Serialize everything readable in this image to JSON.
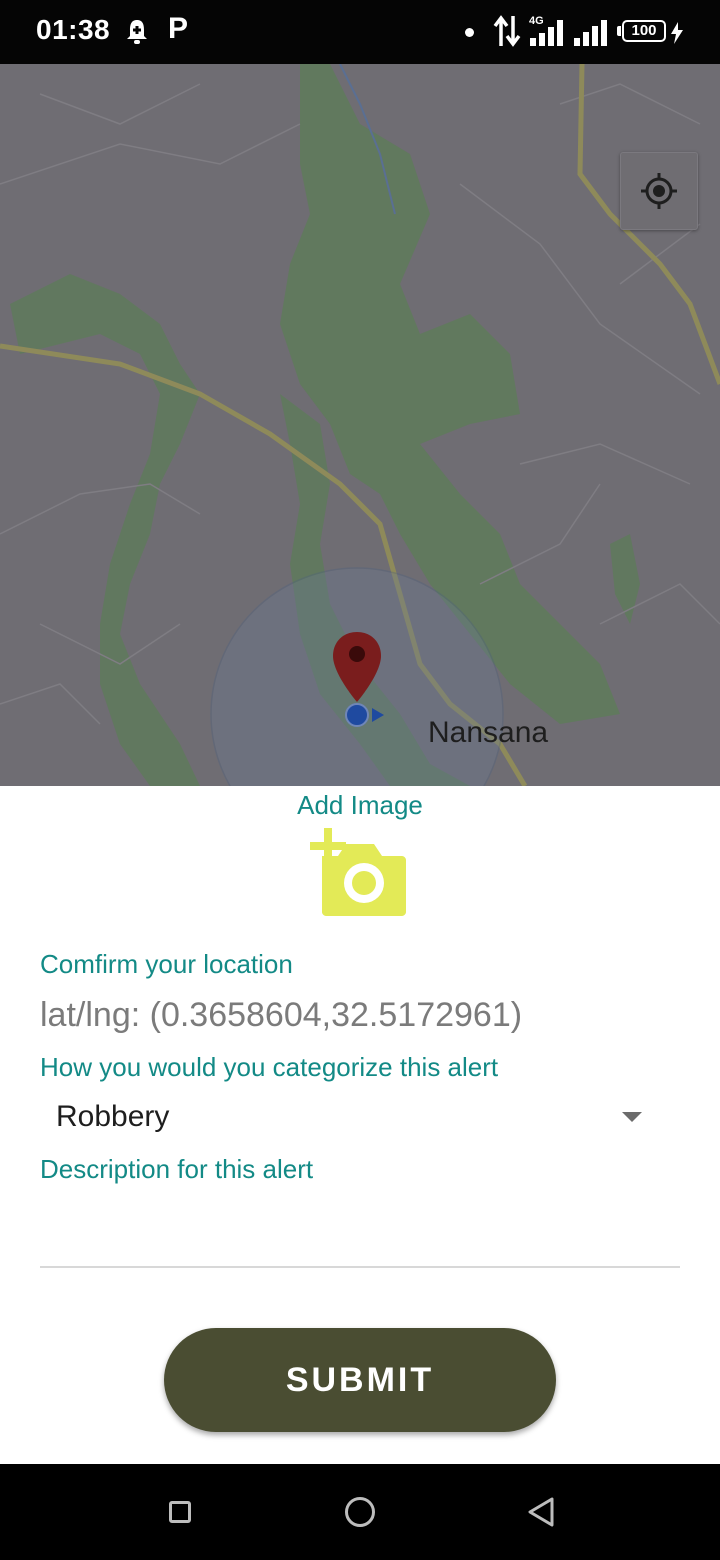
{
  "status_bar": {
    "time": "01:38",
    "p_icon": "P",
    "network": "4G",
    "battery": "100"
  },
  "map": {
    "place_label": "Nansana",
    "icons": [
      "my-location-icon",
      "map-pin-icon",
      "current-location-dot-icon"
    ]
  },
  "form": {
    "add_image_label": "Add Image",
    "camera_icon": "add-photo-icon",
    "confirm_location_label": "Comfirm your location",
    "latlng_text": "lat/lng: (0.3658604,32.5172961)",
    "category_label": "How you would you categorize this alert",
    "category_selected": "Robbery",
    "description_label": "Description for this alert",
    "description_value": "",
    "submit_label": "SUBMIT"
  },
  "colors": {
    "accent": "#138a86",
    "submit_bg": "#4a4d32",
    "camera_icon": "#e3ea57",
    "map_bg": "#6f6d73"
  }
}
